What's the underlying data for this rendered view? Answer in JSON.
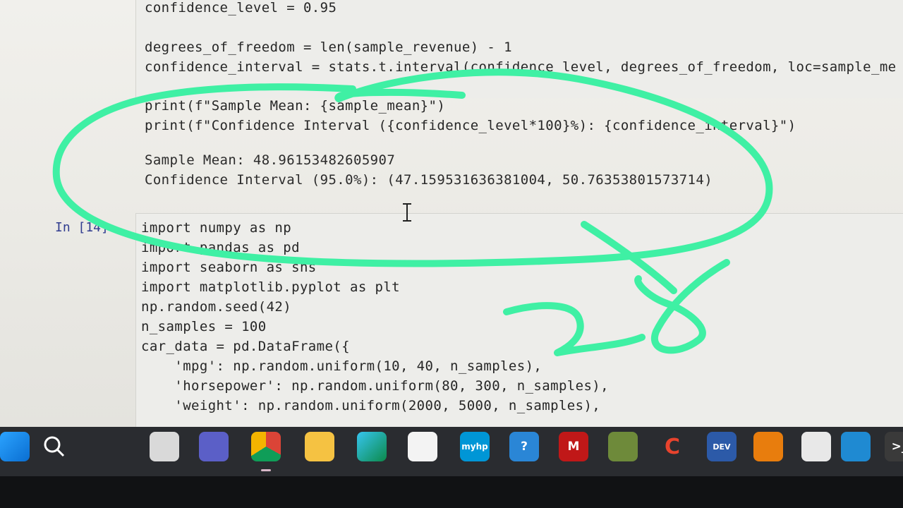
{
  "notebook": {
    "top_cell": {
      "lines": [
        "confidence_level = 0.95",
        "degrees_of_freedom = len(sample_revenue) - 1",
        "confidence_interval = stats.t.interval(confidence_level, degrees_of_freedom, loc=sample_me",
        "print(f\"Sample Mean: {sample_mean}\")",
        "print(f\"Confidence Interval ({confidence_level*100}%): {confidence_interval}\")"
      ],
      "output": [
        "Sample Mean: 48.96153482605907",
        "Confidence Interval (95.0%): (47.159531636381004, 50.76353801573714)"
      ]
    },
    "bottom_cell": {
      "prompt": "In [14]:",
      "lines": [
        "import numpy as np",
        "import pandas as pd",
        "import seaborn as sns",
        "import matplotlib.pyplot as plt",
        "np.random.seed(42)",
        "n_samples = 100",
        "car_data = pd.DataFrame({",
        "    'mpg': np.random.uniform(10, 40, n_samples),",
        "    'horsepower': np.random.uniform(80, 300, n_samples),",
        "    'weight': np.random.uniform(2000, 5000, n_samples),"
      ]
    }
  },
  "annotation": {
    "text": "28",
    "color": "#3ff0a4"
  },
  "taskbar": {
    "icons": [
      {
        "name": "windows-start-icon"
      },
      {
        "name": "search-icon"
      },
      {
        "name": "task-view-icon"
      },
      {
        "name": "teams-icon"
      },
      {
        "name": "chrome-icon"
      },
      {
        "name": "file-explorer-icon"
      },
      {
        "name": "edge-icon"
      },
      {
        "name": "microsoft-store-icon"
      },
      {
        "name": "myhp-icon",
        "label": "myhp"
      },
      {
        "name": "get-help-icon",
        "label": "?"
      },
      {
        "name": "mcafee-icon",
        "label": "M"
      },
      {
        "name": "sticky-app-icon"
      },
      {
        "name": "c-app-icon",
        "label": "C"
      },
      {
        "name": "dev-cpp-icon",
        "label": "DEV"
      },
      {
        "name": "blender-icon"
      },
      {
        "name": "python-file-icon"
      },
      {
        "name": "vscode-icon"
      },
      {
        "name": "terminal-icon",
        "label": ">_"
      }
    ]
  }
}
